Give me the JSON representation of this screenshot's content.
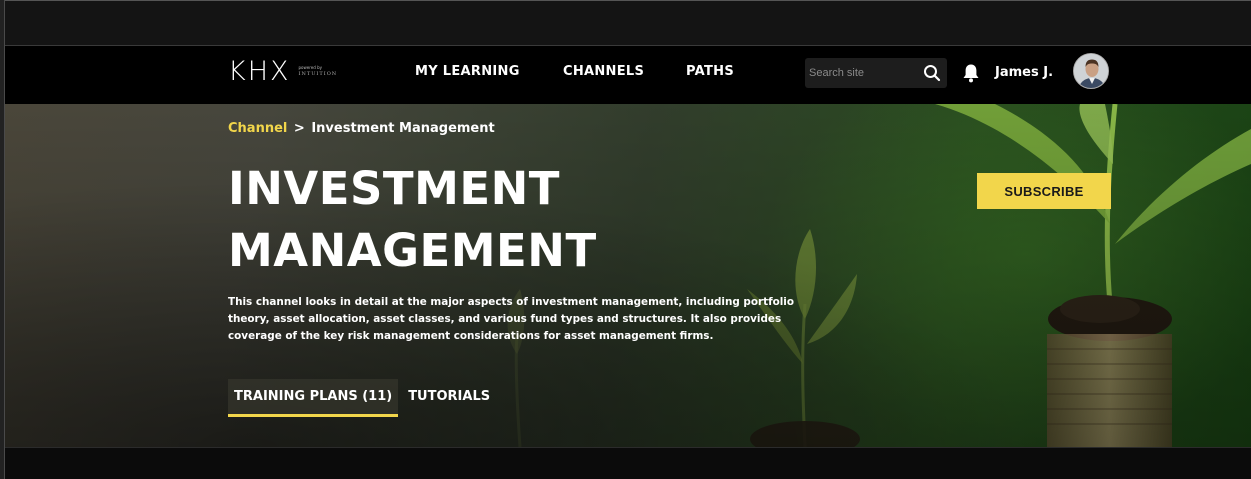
{
  "brand": {
    "logo_text": "KHX",
    "powered_by": "powered by",
    "partner": "INTUITION"
  },
  "nav": {
    "items": [
      {
        "label": "MY LEARNING"
      },
      {
        "label": "CHANNELS"
      },
      {
        "label": "PATHS"
      }
    ],
    "search": {
      "placeholder": "Search site",
      "icon": "search-icon"
    },
    "notifications_icon": "bell-icon",
    "user": {
      "name": "James J.",
      "avatar": "avatar"
    }
  },
  "hero": {
    "breadcrumb": {
      "channel": "Channel",
      "separator": ">",
      "current": "Investment Management"
    },
    "title_line1": "INVESTMENT",
    "title_line2": "MANAGEMENT",
    "description": "This channel looks in detail at the major aspects of investment management, including portfolio theory, asset allocation, asset classes, and various fund types and structures. It also provides coverage of the key risk management considerations for asset management firms.",
    "subscribe_label": "SUBSCRIBE",
    "tabs": [
      {
        "label": "TRAINING PLANS (11)",
        "active": true
      },
      {
        "label": "TUTORIALS",
        "active": false
      }
    ]
  },
  "colors": {
    "accent": "#f2d64b",
    "nav_bg": "#000000",
    "text": "#ffffff"
  }
}
